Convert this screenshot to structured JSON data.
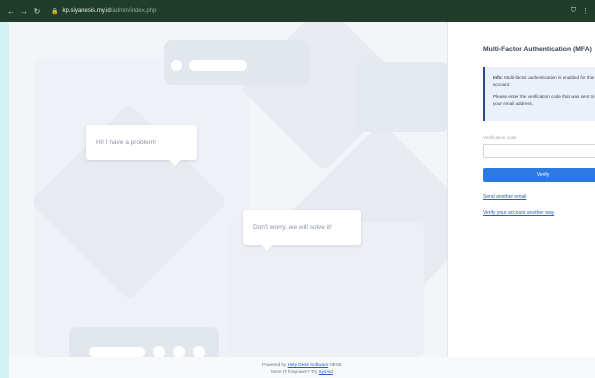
{
  "browser": {
    "back": "←",
    "forward": "→",
    "reload": "↻",
    "lock": "🔒",
    "url_host": "kp.siyanesis.my.id",
    "url_path": "/admin/index.php",
    "shield_icon": "⛉",
    "menu_icon": "⋮"
  },
  "illustration": {
    "bubble_problem": "Hi! I have a problem!",
    "bubble_solve": "Don't worry, we will solve it!"
  },
  "mfa": {
    "title": "Multi-Factor Authentication (MFA)",
    "info_label": "Info:",
    "info_text": " Multi-factor authentication is enabled for this account.",
    "info_text2": "Please enter the verification code that was sent to your email address.",
    "code_label": "Verification code",
    "code_value": "",
    "verify_button": "Verify",
    "send_email_link": "Send another email",
    "verify_other_link": "Verify your account another way"
  },
  "footer": {
    "powered_by": "Powered by ",
    "helpdesk_link": "Help Desk Software",
    "brand": " HESK",
    "line2": "More IT firepower? Try ",
    "sysaid_link": "SysAid"
  },
  "colors": {
    "browser_bar": "#1f3d2a",
    "accent": "#2c79e2",
    "info_border": "#2a4b8d",
    "outer_bg": "#d3f3f3"
  }
}
